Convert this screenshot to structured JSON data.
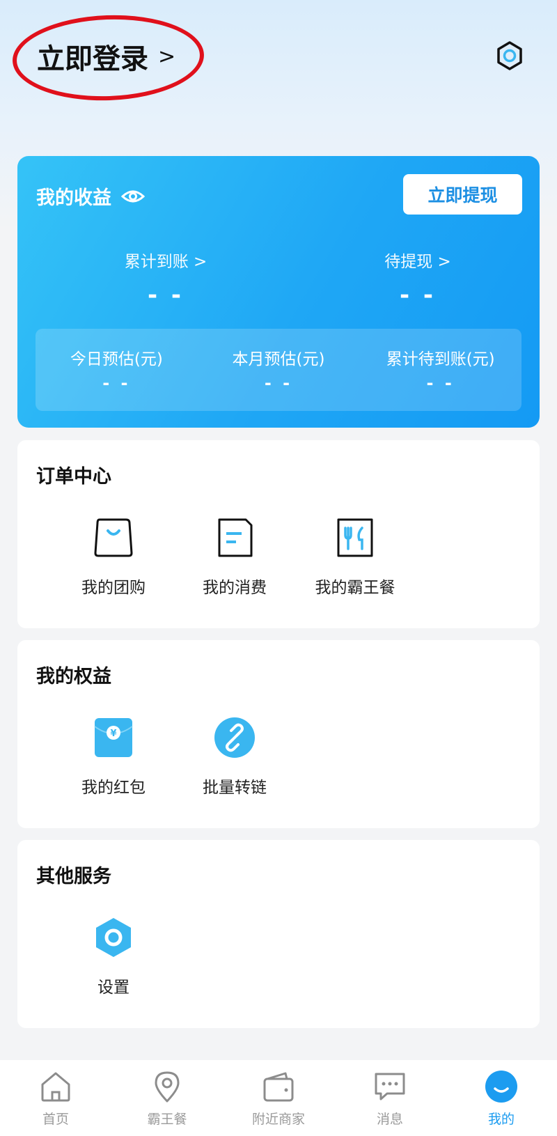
{
  "header": {
    "login_label": "立即登录",
    "login_chevron": ">",
    "settings_icon": "hexagon-gear-icon"
  },
  "earnings": {
    "title": "我的收益",
    "withdraw_button": "立即提现",
    "total_received_label": "累计到账 >",
    "total_received_value": "- -",
    "pending_withdraw_label": "待提现 >",
    "pending_withdraw_value": "- -",
    "today_label": "今日预估(元)",
    "today_value": "- -",
    "month_label": "本月预估(元)",
    "month_value": "- -",
    "pending_total_label": "累计待到账(元)",
    "pending_total_value": "- -"
  },
  "orders": {
    "title": "订单中心",
    "items": [
      {
        "label": "我的团购",
        "icon": "shopping-bag-icon"
      },
      {
        "label": "我的消费",
        "icon": "receipt-icon"
      },
      {
        "label": "我的霸王餐",
        "icon": "cutlery-icon"
      }
    ]
  },
  "benefits": {
    "title": "我的权益",
    "items": [
      {
        "label": "我的红包",
        "icon": "red-packet-icon"
      },
      {
        "label": "批量转链",
        "icon": "link-icon"
      }
    ]
  },
  "services": {
    "title": "其他服务",
    "items": [
      {
        "label": "设置",
        "icon": "settings-icon"
      }
    ]
  },
  "tabbar": {
    "items": [
      {
        "label": "首页",
        "icon": "home-icon",
        "active": false
      },
      {
        "label": "霸王餐",
        "icon": "location-pin-icon",
        "active": false
      },
      {
        "label": "附近商家",
        "icon": "wallet-icon",
        "active": false
      },
      {
        "label": "消息",
        "icon": "chat-icon",
        "active": false
      },
      {
        "label": "我的",
        "icon": "profile-icon",
        "active": true
      }
    ]
  },
  "colors": {
    "accent": "#1c9cf0",
    "annotation_red": "#e0101b"
  }
}
